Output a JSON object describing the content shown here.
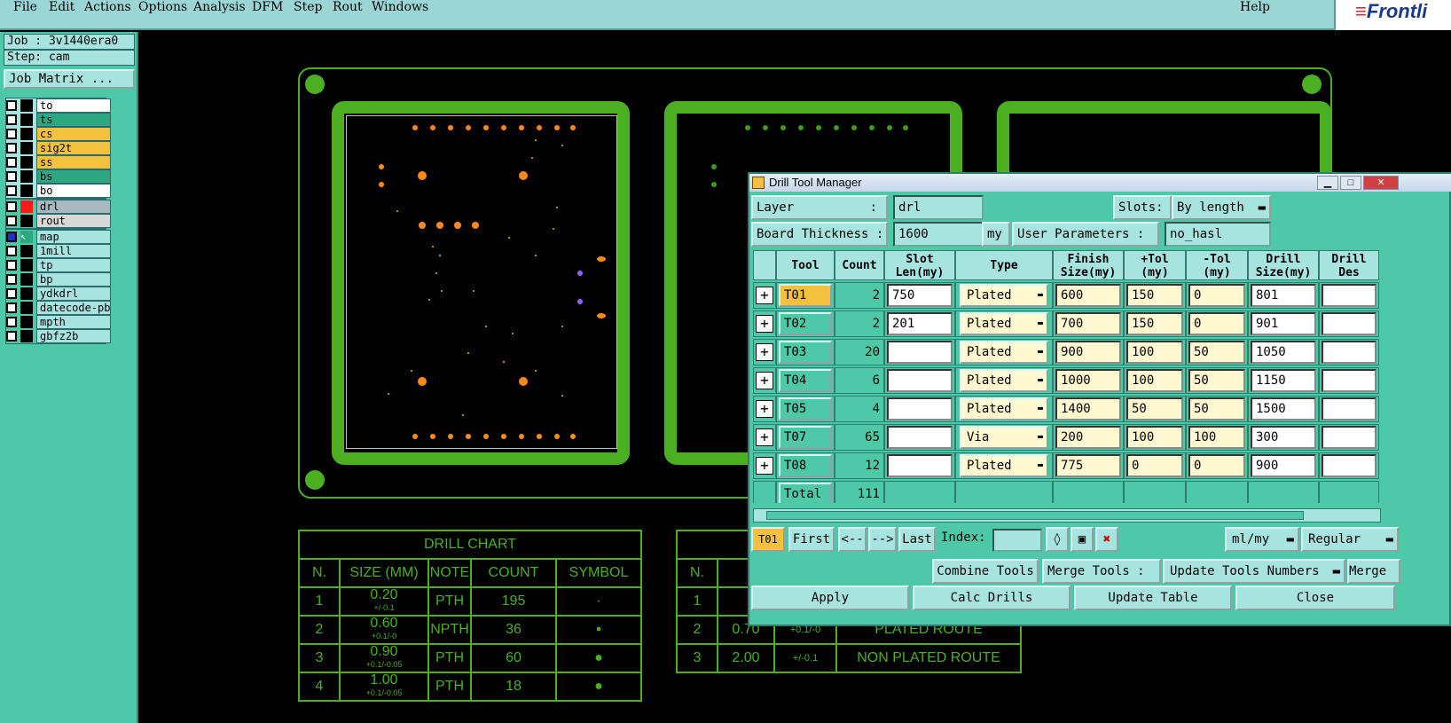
{
  "menu": {
    "file": "File",
    "edit": "Edit",
    "actions": "Actions",
    "options": "Options",
    "analysis": "Analysis",
    "dfm": "DFM",
    "step": "Step",
    "rout": "Rout",
    "windows": "Windows",
    "help": "Help",
    "logo": "Frontli"
  },
  "job": {
    "job_label": "Job : 3v1440era0",
    "step_label": "Step: cam",
    "matrix_button": "Job Matrix ..."
  },
  "layers": {
    "group1": [
      {
        "name": "to",
        "color": "#ffffff"
      },
      {
        "name": "ts",
        "color": "#2ea882"
      },
      {
        "name": "cs",
        "color": "#f4c040"
      },
      {
        "name": "sig2t",
        "color": "#f4c040"
      },
      {
        "name": "ss",
        "color": "#f4c040"
      },
      {
        "name": "bs",
        "color": "#2ea882"
      },
      {
        "name": "bo",
        "color": "#ffffff"
      }
    ],
    "group2": [
      {
        "name": "drl",
        "color": "#a7b8c0",
        "swatch": "#ff1a1a"
      },
      {
        "name": "rout",
        "color": "#d8d8d8"
      }
    ],
    "group3": [
      {
        "name": "map",
        "color": "#a7e4e0"
      },
      {
        "name": "1mill",
        "color": "#a7e4e0"
      },
      {
        "name": "tp",
        "color": "#a7e4e0"
      },
      {
        "name": "bp",
        "color": "#a7e4e0"
      },
      {
        "name": "ydkdrl",
        "color": "#a7e4e0"
      },
      {
        "name": "datecode-pbo",
        "color": "#a7e4e0"
      },
      {
        "name": "mpth",
        "color": "#a7e4e0"
      },
      {
        "name": "gbfz2b",
        "color": "#a7e4e0"
      }
    ]
  },
  "drill_chart": {
    "title": "DRILL CHART",
    "headers": [
      "N.",
      "SIZE (MM)",
      "NOTE",
      "COUNT",
      "SYMBOL"
    ],
    "rows": [
      {
        "n": "1",
        "size": "0.20",
        "tol": "+/-0.1",
        "note": "PTH",
        "count": "195",
        "symbol": "·"
      },
      {
        "n": "2",
        "size": "0.60",
        "tol": "+0.1/-0",
        "note": "NPTH",
        "count": "36",
        "symbol": "▪"
      },
      {
        "n": "3",
        "size": "0.90",
        "tol": "+0.1/-0.05",
        "note": "PTH",
        "count": "60",
        "symbol": "●"
      },
      {
        "n": "4",
        "size": "1.00",
        "tol": "+0.1/-0.05",
        "note": "PTH",
        "count": "18",
        "symbol": "●"
      }
    ]
  },
  "rout_chart": {
    "header_n": "N.",
    "rows": [
      {
        "n": "1",
        "size": "",
        "tol": "",
        "note": ""
      },
      {
        "n": "2",
        "size": "0.70",
        "tol": "+0.1/-0",
        "note": "PLATED ROUTE"
      },
      {
        "n": "3",
        "size": "2.00",
        "tol": "+/-0.1",
        "note": "NON PLATED ROUTE"
      }
    ]
  },
  "dialog": {
    "title": "Drill Tool Manager",
    "layer_label": "Layer",
    "layer_colon": ":",
    "layer_value": "drl",
    "slots_label": "Slots:",
    "slots_value": "By length",
    "board_thickness_label": "Board Thickness :",
    "board_thickness_value": "1600",
    "board_thickness_unit": "my",
    "user_params_label": "User Parameters :",
    "user_params_value": "no_hasl",
    "headers": {
      "tool": "Tool",
      "count": "Count",
      "slot": "Slot\nLen(my)",
      "type": "Type",
      "finish": "Finish\nSize(my)",
      "ptol": "+Tol\n(my)",
      "mtol": "-Tol\n(my)",
      "drill": "Drill\nSize(my)",
      "des": "Drill\nDes"
    },
    "tools": [
      {
        "tool": "T01",
        "count": "2",
        "slot": "750",
        "type": "Plated",
        "finish": "600",
        "ptol": "150",
        "mtol": "0",
        "drill": "801"
      },
      {
        "tool": "T02",
        "count": "2",
        "slot": "201",
        "type": "Plated",
        "finish": "700",
        "ptol": "150",
        "mtol": "0",
        "drill": "901"
      },
      {
        "tool": "T03",
        "count": "20",
        "slot": "",
        "type": "Plated",
        "finish": "900",
        "ptol": "100",
        "mtol": "50",
        "drill": "1050"
      },
      {
        "tool": "T04",
        "count": "6",
        "slot": "",
        "type": "Plated",
        "finish": "1000",
        "ptol": "100",
        "mtol": "50",
        "drill": "1150"
      },
      {
        "tool": "T05",
        "count": "4",
        "slot": "",
        "type": "Plated",
        "finish": "1400",
        "ptol": "50",
        "mtol": "50",
        "drill": "1500"
      },
      {
        "tool": "T07",
        "count": "65",
        "slot": "",
        "type": "Via",
        "finish": "200",
        "ptol": "100",
        "mtol": "100",
        "drill": "300"
      },
      {
        "tool": "T08",
        "count": "12",
        "slot": "",
        "type": "Plated",
        "finish": "775",
        "ptol": "0",
        "mtol": "0",
        "drill": "900"
      }
    ],
    "total_label": "Total",
    "total_value": "111",
    "current_tool": "T01",
    "first": "First",
    "prev": "<--",
    "next": "-->",
    "last": "Last",
    "index_label": "Index:",
    "units_value": "ml/my",
    "mode_value": "Regular",
    "combine": "Combine Tools",
    "merge_label": "Merge Tools :",
    "update_numbers": "Update Tools Numbers",
    "merge_cut": "Merge",
    "apply": "Apply",
    "calc": "Calc Drills",
    "update_table": "Update Table",
    "close": "Close"
  }
}
